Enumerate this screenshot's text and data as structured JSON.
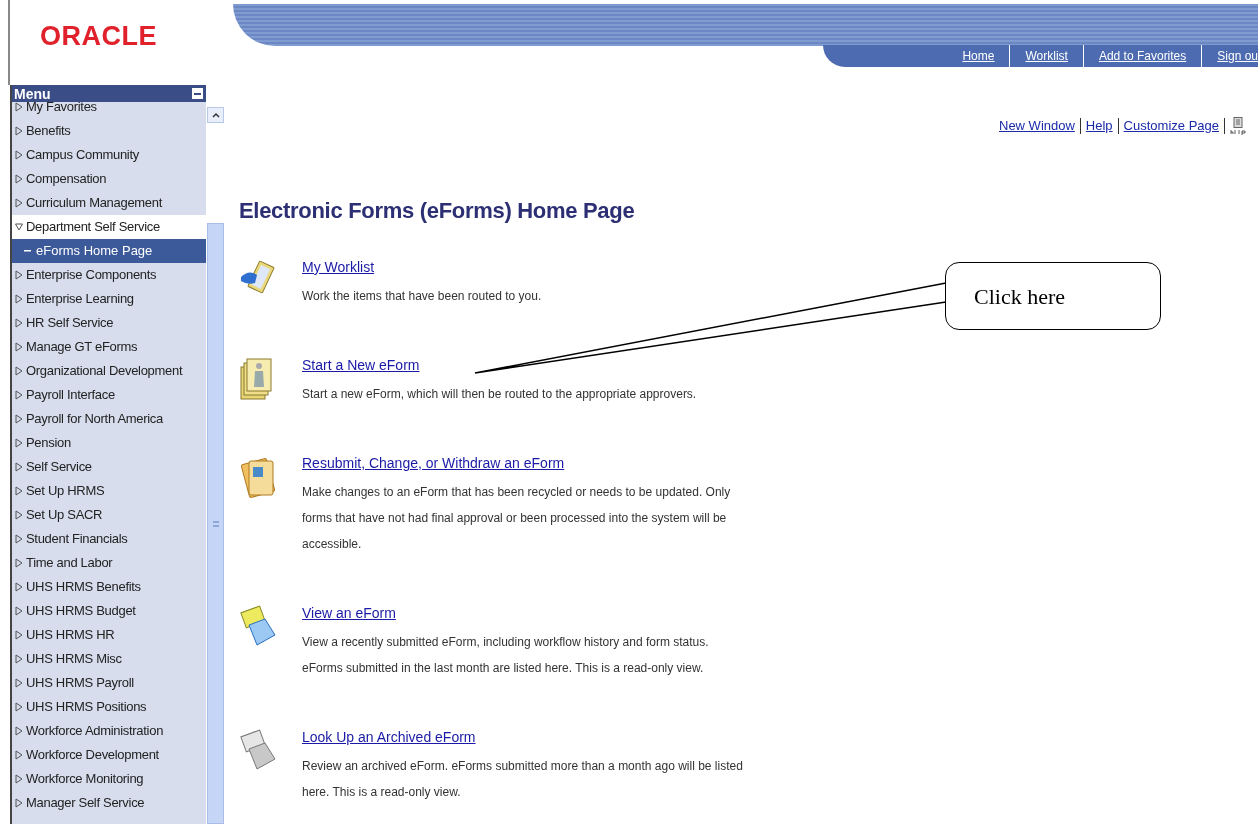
{
  "logo": {
    "text": "ORACLE"
  },
  "nav": [
    {
      "label": "Home"
    },
    {
      "label": "Worklist"
    },
    {
      "label": "Add to Favorites"
    },
    {
      "label": "Sign ou"
    }
  ],
  "page_links": [
    {
      "label": "New Window"
    },
    {
      "label": "Help"
    },
    {
      "label": "Customize Page"
    }
  ],
  "menu": {
    "title": "Menu",
    "items": [
      {
        "label": "My Favorites",
        "expanded": false
      },
      {
        "label": "Benefits",
        "expanded": false
      },
      {
        "label": "Campus Community",
        "expanded": false
      },
      {
        "label": "Compensation",
        "expanded": false
      },
      {
        "label": "Curriculum Management",
        "expanded": false
      },
      {
        "label": "Department Self Service",
        "expanded": true,
        "children": [
          {
            "label": "eForms Home Page",
            "selected": true
          }
        ]
      },
      {
        "label": "Enterprise Components",
        "expanded": false
      },
      {
        "label": "Enterprise Learning",
        "expanded": false
      },
      {
        "label": "HR Self Service",
        "expanded": false
      },
      {
        "label": "Manage GT eForms",
        "expanded": false
      },
      {
        "label": "Organizational Development",
        "expanded": false
      },
      {
        "label": "Payroll Interface",
        "expanded": false
      },
      {
        "label": "Payroll for North America",
        "expanded": false
      },
      {
        "label": "Pension",
        "expanded": false
      },
      {
        "label": "Self Service",
        "expanded": false
      },
      {
        "label": "Set Up HRMS",
        "expanded": false
      },
      {
        "label": "Set Up SACR",
        "expanded": false
      },
      {
        "label": "Student Financials",
        "expanded": false
      },
      {
        "label": "Time and Labor",
        "expanded": false
      },
      {
        "label": "UHS HRMS Benefits",
        "expanded": false
      },
      {
        "label": "UHS HRMS Budget",
        "expanded": false
      },
      {
        "label": "UHS HRMS HR",
        "expanded": false
      },
      {
        "label": "UHS HRMS Misc",
        "expanded": false
      },
      {
        "label": "UHS HRMS Payroll",
        "expanded": false
      },
      {
        "label": "UHS HRMS Positions",
        "expanded": false
      },
      {
        "label": "Workforce Administration",
        "expanded": false
      },
      {
        "label": "Workforce Development",
        "expanded": false
      },
      {
        "label": "Workforce Monitoring",
        "expanded": false
      },
      {
        "label": "Manager Self Service",
        "expanded": false
      }
    ]
  },
  "heading": "Electronic Forms (eForms) Home Page",
  "entries": [
    {
      "title": "My Worklist",
      "description": "Work the items that have been routed to you."
    },
    {
      "title": "Start a New eForm",
      "description": "Start a new eForm, which will then be routed to the appropriate approvers."
    },
    {
      "title": "Resubmit, Change, or Withdraw an eForm",
      "description": "Make changes to an eForm that has been recycled or needs to be updated. Only forms that have not had final approval or been processed into the system will be accessible."
    },
    {
      "title": "View an eForm",
      "description": "View a recently submitted eForm, including workflow history and form status. eForms submitted in the last month are listed here. This is a read-only view."
    },
    {
      "title": "Look Up an Archived eForm",
      "description": "Review an archived eForm. eForms submitted more than a month ago will be listed here. This is a read-only view."
    }
  ],
  "callout": {
    "text": "Click here"
  }
}
